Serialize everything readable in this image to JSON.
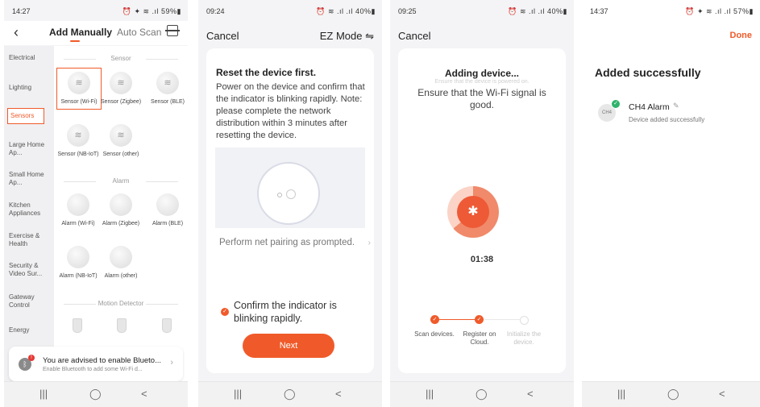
{
  "screens": [
    {
      "status": {
        "time": "14:27",
        "icons": "⏰ ✦ ≋ .ıl 59%▮"
      },
      "header": {
        "tab_manual": "Add Manually",
        "tab_auto": "Auto Scan"
      },
      "categories": [
        "Electrical",
        "Lighting",
        "Sensors",
        "Large Home Ap...",
        "Small Home Ap...",
        "Kitchen Appliances",
        "Exercise & Health",
        "Security & Video Sur...",
        "Gateway Control",
        "Energy"
      ],
      "sections": {
        "sensor": "Sensor",
        "alarm": "Alarm",
        "motion": "Motion Detector"
      },
      "sensor_devices": [
        "Sensor (Wi-Fi)",
        "Sensor (Zigbee)",
        "Sensor (BLE)",
        "Sensor (NB-IoT)",
        "Sensor (other)"
      ],
      "alarm_devices": [
        "Alarm (Wi-Fi)",
        "Alarm (Zigbee)",
        "Alarm (BLE)",
        "Alarm (NB-IoT)",
        "Alarm (other)"
      ],
      "banner": {
        "title": "You are advised to enable Blueto...",
        "subtitle": "Enable Bluetooth to add some Wi-Fi d..."
      }
    },
    {
      "status": {
        "time": "09:24",
        "icons": "⏰ ≋ .ıl .ıl 40%▮"
      },
      "header": {
        "cancel": "Cancel",
        "mode": "EZ Mode ⇋"
      },
      "reset_title": "Reset the device first.",
      "reset_text": "Power on the device and confirm that the indicator is blinking rapidly. Note: please complete the network distribution within 3 minutes after resetting the device.",
      "perform": "Perform net pairing as prompted.",
      "confirm": "Confirm the indicator is blinking rapidly.",
      "next": "Next"
    },
    {
      "status": {
        "time": "09:25",
        "icons": "⏰ ≋ .ıl .ıl 40%▮"
      },
      "header": {
        "cancel": "Cancel"
      },
      "adding": "Adding device...",
      "ghost": "Ensure that the device is powered on.",
      "wifi_note": "Ensure that the Wi-Fi signal is good.",
      "timer": "01:38",
      "progress": {
        "completed_steps": 2,
        "total_steps": 3
      },
      "steps": [
        "Scan devices.",
        "Register on Cloud.",
        "Initialize the device."
      ]
    },
    {
      "status": {
        "time": "14:37",
        "icons": "⏰ ✦ ≋ .ıl .ıl 57%▮"
      },
      "done": "Done",
      "title": "Added successfully",
      "device_icon_text": "CH4",
      "device_name": "CH4 Alarm",
      "device_status": "Device added successfully"
    }
  ],
  "navbar": {
    "recents": "|||",
    "home": "◯",
    "back": "<"
  },
  "colors": {
    "accent": "#f05a2a",
    "success": "#2fb36b"
  }
}
